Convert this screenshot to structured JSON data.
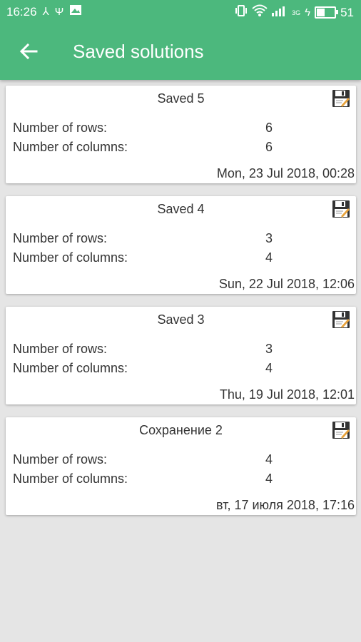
{
  "status_bar": {
    "time": "16:26",
    "left_icons": [
      "usb-share-icon",
      "usb-icon",
      "image-icon"
    ],
    "right_icons": [
      "vibrate-icon",
      "wifi-icon",
      "signal-icon",
      "charging-icon"
    ],
    "network": "3G",
    "battery_level": "51",
    "battery_fraction": 0.51
  },
  "toolbar": {
    "back_icon": "arrow-left-icon",
    "title": "Saved solutions",
    "color": "#4cb87d"
  },
  "solutions": [
    {
      "title": "Saved 5",
      "rows_label": "Number of rows:",
      "rows_value": "6",
      "cols_label": "Number of columns:",
      "cols_value": "6",
      "date": "Mon, 23 Jul 2018, 00:28"
    },
    {
      "title": "Saved 4",
      "rows_label": "Number of rows:",
      "rows_value": "3",
      "cols_label": "Number of columns:",
      "cols_value": "4",
      "date": "Sun, 22 Jul 2018, 12:06"
    },
    {
      "title": "Saved 3",
      "rows_label": "Number of rows:",
      "rows_value": "3",
      "cols_label": "Number of columns:",
      "cols_value": "4",
      "date": "Thu, 19 Jul 2018, 12:01"
    },
    {
      "title": "Сохранение 2",
      "rows_label": "Number of rows:",
      "rows_value": "4",
      "cols_label": "Number of columns:",
      "cols_value": "4",
      "date": "вт, 17 июля 2018, 17:16"
    }
  ]
}
